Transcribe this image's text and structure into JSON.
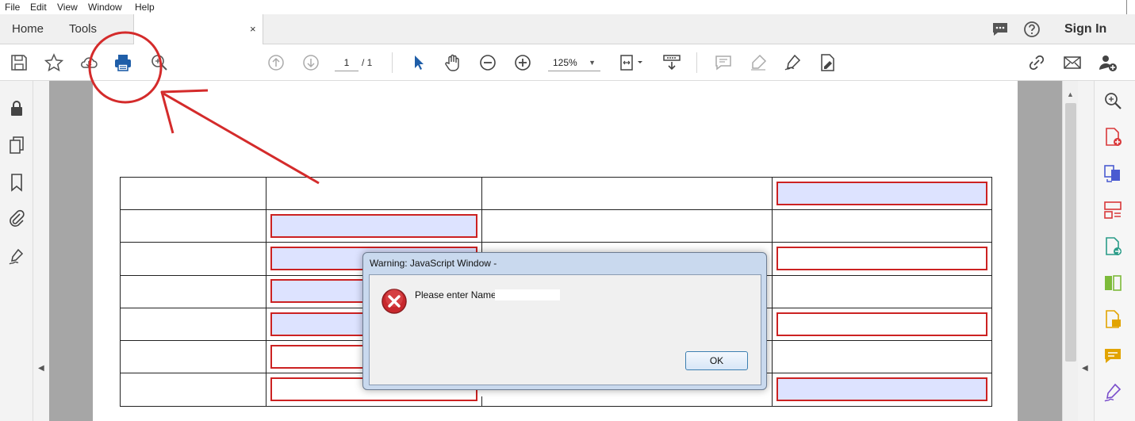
{
  "menu": {
    "items": [
      "File",
      "Edit",
      "View",
      "Window",
      "Help"
    ]
  },
  "tabs": {
    "home": "Home",
    "tools": "Tools",
    "doc_close": "×"
  },
  "header": {
    "sign_in": "Sign In"
  },
  "toolbar": {
    "page_current": "1",
    "page_total": "/ 1",
    "zoom": "125%",
    "zoom_caret": "▼"
  },
  "panels": {
    "collapse_left": "◀",
    "collapse_right": "◀",
    "scroll_up": "▲"
  },
  "dialog": {
    "title": "Warning: JavaScript Window -",
    "message": "Please enter Name",
    "ok_label": "OK"
  },
  "icons": {
    "toolbar": [
      "save-icon",
      "star-icon",
      "cloud-icon",
      "print-icon",
      "zoom-search-icon",
      "page-up-icon",
      "page-down-icon",
      "select-cursor-icon",
      "hand-icon",
      "zoom-out-icon",
      "zoom-in-icon",
      "fit-page-icon",
      "scroll-mode-icon",
      "comment-icon",
      "highlight-icon",
      "sign-icon",
      "edit-pdf-icon",
      "share-link-icon",
      "email-icon",
      "add-user-icon"
    ],
    "left_panel": [
      "lock-icon",
      "pages-icon",
      "bookmark-icon",
      "attachment-icon",
      "signature-icon"
    ],
    "right_panel": [
      "zoom-search-icon",
      "create-pdf-icon",
      "combine-files-icon",
      "organize-pages-icon",
      "export-pdf-icon",
      "compare-icon",
      "comment-icon",
      "comment-note-icon",
      "fill-sign-icon"
    ]
  },
  "colors": {
    "annotation": "#d42b2b",
    "form_field_fill": "#dde3ff",
    "form_field_border": "#cc2222",
    "print_icon": "#1f5ea8"
  }
}
